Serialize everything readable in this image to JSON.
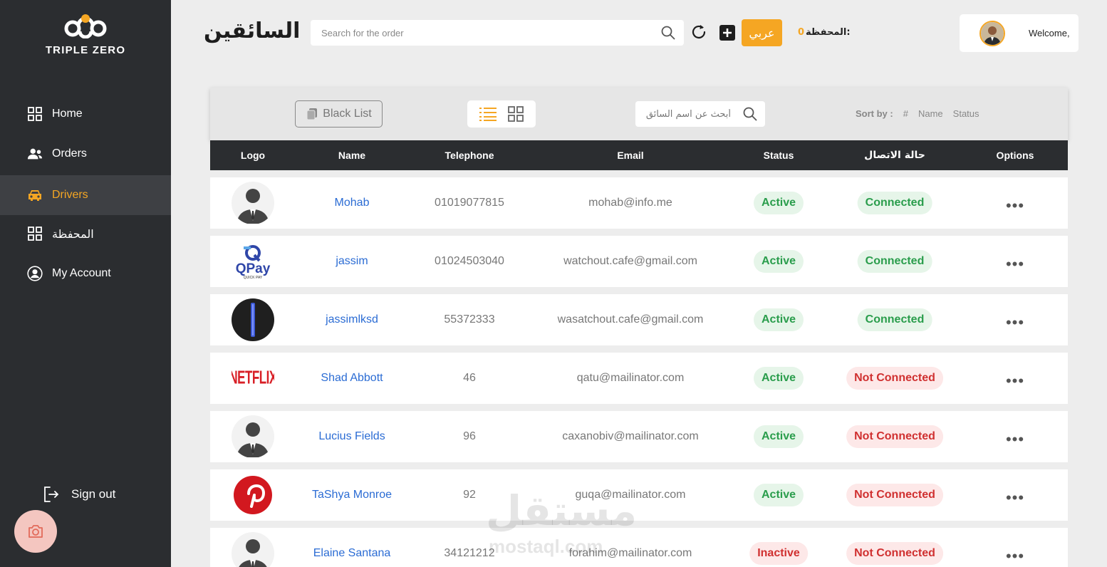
{
  "brand": {
    "name": "TRIPLE ZERO"
  },
  "sidebar": {
    "items": [
      {
        "label": "Home",
        "icon": "grid-icon",
        "active": false
      },
      {
        "label": "Orders",
        "icon": "users-icon",
        "active": false
      },
      {
        "label": "Drivers",
        "icon": "car-icon",
        "active": true
      },
      {
        "label": "المحفظة",
        "icon": "grid-icon",
        "active": false
      },
      {
        "label": "My Account",
        "icon": "user-circle-icon",
        "active": false
      }
    ],
    "signout_label": "Sign out"
  },
  "header": {
    "title": "السائقين",
    "search_placeholder": "Search for the order",
    "lang_label": "عربي",
    "wallet_label": "المحفظة:",
    "wallet_amount": "0",
    "welcome": "Welcome,"
  },
  "toolbar": {
    "blacklist_label": "Black List",
    "driver_search_placeholder": "أبحث عن اسم السائق",
    "sort_label": "Sort by :",
    "sort_options": [
      "#",
      "Name",
      "Status"
    ]
  },
  "table": {
    "columns": [
      "Logo",
      "Name",
      "Telephone",
      "Email",
      "Status",
      "حالة الاتصال",
      "Options"
    ],
    "rows": [
      {
        "logo": "person-silhouette",
        "name": "Mohab",
        "phone": "01019077815",
        "email": "mohab@info.me",
        "status": "Active",
        "connection": "Connected"
      },
      {
        "logo": "qpay",
        "name": "jassim",
        "phone": "01024503040",
        "email": "watchout.cafe@gmail.com",
        "status": "Active",
        "connection": "Connected"
      },
      {
        "logo": "dark-circle",
        "name": "jassimlksd",
        "phone": "55372333",
        "email": "wasatchout.cafe@gmail.com",
        "status": "Active",
        "connection": "Connected"
      },
      {
        "logo": "netflix",
        "name": "Shad Abbott",
        "phone": "46",
        "email": "qatu@mailinator.com",
        "status": "Active",
        "connection": "Not Connected"
      },
      {
        "logo": "person-silhouette",
        "name": "Lucius Fields",
        "phone": "96",
        "email": "caxanobiv@mailinator.com",
        "status": "Active",
        "connection": "Not Connected"
      },
      {
        "logo": "pinterest",
        "name": "TaShya Monroe",
        "phone": "92",
        "email": "guqa@mailinator.com",
        "status": "Active",
        "connection": "Not Connected"
      },
      {
        "logo": "person-silhouette",
        "name": "Elaine Santana",
        "phone": "34121212",
        "email": "forahim@mailinator.com",
        "status": "Inactive",
        "connection": "Not Connected"
      }
    ],
    "options_label": "•••"
  },
  "logos": {
    "qpay_text": "QPay",
    "qpay_sub": "QUICK PAY",
    "netflix_text": "NETFLIX"
  },
  "watermark": {
    "text": "مستقل",
    "sub": "mostaql.com"
  },
  "colors": {
    "accent": "#f5a623",
    "sidebar": "#2b2d30",
    "link": "#2b6cd4",
    "active_green": "#2a9d4c",
    "inactive_red": "#d03030"
  }
}
